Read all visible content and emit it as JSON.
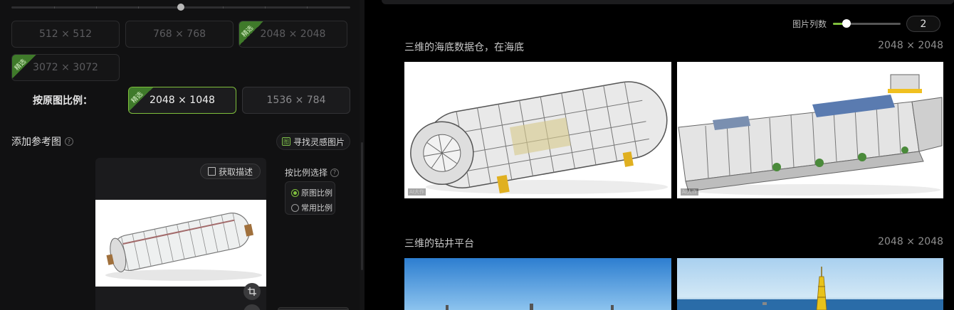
{
  "sizes": {
    "row1": [
      "512 × 512",
      "768 × 768",
      "2048 × 2048"
    ],
    "row2": [
      "3072 × 3072"
    ],
    "badge_text": "精选",
    "ratio_label": "按原图比例：",
    "ratio_sizes": [
      "2048 × 1048",
      "1536 × 784"
    ]
  },
  "reference": {
    "title": "添加参考图",
    "help": "?",
    "inspire_icon": "图",
    "inspire_label": "寻找灵感图片",
    "get_desc_label": "获取描述",
    "ratio_select_title": "按比例选择",
    "options": [
      "原图比例",
      "常用比例"
    ]
  },
  "toolbar": {
    "columns_label": "图片列数",
    "columns_value": "2",
    "columns_fraction": 0.2
  },
  "gallery": {
    "groups": [
      {
        "title": "三维的海底数据仓，在海底",
        "size": "2048 × 2048",
        "watermark": "AI大作"
      },
      {
        "title": "三维的钻井平台",
        "size": "2048 × 2048"
      }
    ]
  },
  "colors": {
    "accent": "#7fbf3c",
    "badge": "#3f7a2a",
    "panel": "#111112"
  },
  "icons": [
    "help-icon",
    "image-icon",
    "document-icon",
    "crop-icon",
    "radio-icon"
  ]
}
